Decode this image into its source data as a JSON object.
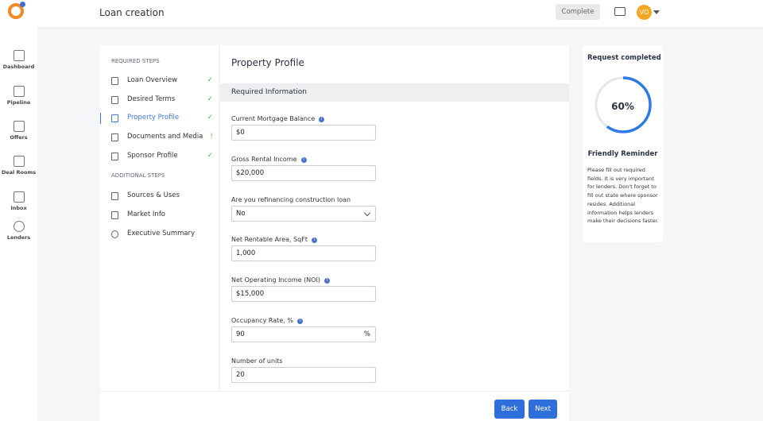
{
  "header": {
    "title": "Loan creation",
    "complete_label": "Complete",
    "avatar_initials": "VO"
  },
  "nav": [
    {
      "label": "Dashboard"
    },
    {
      "label": "Pipeline"
    },
    {
      "label": "Offers"
    },
    {
      "label": "Deal Rooms"
    },
    {
      "label": "Inbox"
    },
    {
      "label": "Lenders"
    }
  ],
  "steps": {
    "required_heading": "REQUIRED STEPS",
    "additional_heading": "ADDITIONAL STEPS",
    "required": [
      {
        "label": "Loan Overview",
        "status": "✓"
      },
      {
        "label": "Desired Terms",
        "status": "✓"
      },
      {
        "label": "Property Profile",
        "status": "✓"
      },
      {
        "label": "Documents and Media",
        "status": "!"
      },
      {
        "label": "Sponsor Profile",
        "status": "✓"
      }
    ],
    "additional": [
      {
        "label": "Sources & Uses"
      },
      {
        "label": "Market Info"
      },
      {
        "label": "Executive Summary"
      }
    ]
  },
  "form": {
    "title": "Property Profile",
    "section": "Required Information",
    "fields": [
      {
        "label": "Current Mortgage Balance",
        "value": "$0"
      },
      {
        "label": "Gross Rental Income",
        "value": "$20,000"
      },
      {
        "label": "Are you refinancing construction loan",
        "value": "No"
      },
      {
        "label": "Net Rentable Area, SqFt",
        "value": "1,000"
      },
      {
        "label": "Net Operating Income (NOI)",
        "value": "$15,000"
      },
      {
        "label": "Occupancy Rate, %",
        "value": "90",
        "suffix": "%"
      },
      {
        "label": "Number of units",
        "value": "20"
      }
    ]
  },
  "footer": {
    "back_label": "Back",
    "next_label": "Next"
  },
  "progress": {
    "title": "Request completed",
    "percent_label": "60%",
    "percent": 60,
    "reminder_title": "Friendly Reminder",
    "reminder_text": "Please fill out required fields. It is very important for lenders. Don't forget to fill out state where sponsor resides. Additional information helps lenders make their decisions faster."
  }
}
